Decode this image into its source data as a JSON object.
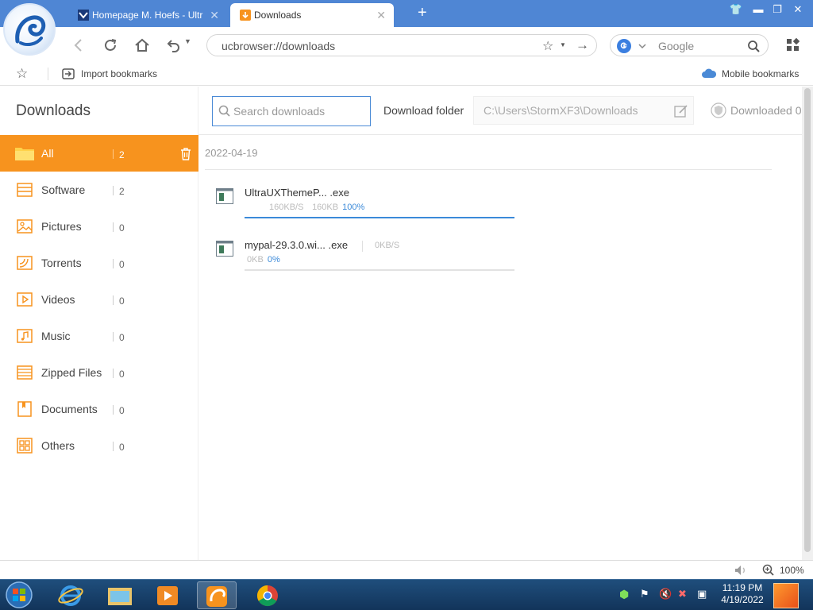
{
  "browser": {
    "tabs": [
      {
        "label": "Homepage M. Hoefs - Ultr",
        "active": false
      },
      {
        "label": "Downloads",
        "active": true
      }
    ],
    "address": "ucbrowser://downloads",
    "search_engine_label": "Google",
    "bookmarks": {
      "import_label": "Import bookmarks",
      "mobile_label": "Mobile bookmarks"
    },
    "zoom": "100%"
  },
  "sidebar": {
    "title": "Downloads",
    "categories": [
      {
        "label": "All",
        "count": "2",
        "icon": "folder-icon",
        "active": true
      },
      {
        "label": "Software",
        "count": "2",
        "icon": "software-icon"
      },
      {
        "label": "Pictures",
        "count": "0",
        "icon": "picture-icon"
      },
      {
        "label": "Torrents",
        "count": "0",
        "icon": "torrent-icon"
      },
      {
        "label": "Videos",
        "count": "0",
        "icon": "video-icon"
      },
      {
        "label": "Music",
        "count": "0",
        "icon": "music-icon"
      },
      {
        "label": "Zipped Files",
        "count": "0",
        "icon": "zip-icon"
      },
      {
        "label": "Documents",
        "count": "0",
        "icon": "document-icon"
      },
      {
        "label": "Others",
        "count": "0",
        "icon": "others-icon"
      }
    ]
  },
  "main": {
    "search_placeholder": "Search downloads",
    "folder_label": "Download folder",
    "folder_path": "C:\\Users\\StormXF3\\Downloads",
    "downloaded_label": "Downloaded 0",
    "date_group": "2022-04-19",
    "downloads": [
      {
        "name": "UltraUXThemeP... .exe",
        "speed": "160KB/S",
        "size": "160KB",
        "progress_label": "100%",
        "progress": 1.0
      },
      {
        "name": "mypal-29.3.0.wi... .exe",
        "speed": "0KB/S",
        "size": "0KB",
        "progress_label": "0%",
        "progress": 0.0
      }
    ]
  },
  "taskbar": {
    "time": "11:19 PM",
    "date": "4/19/2022"
  },
  "colors": {
    "accent": "#f7931e",
    "titlebar": "#4f86d4",
    "link": "#3b8ad9"
  }
}
